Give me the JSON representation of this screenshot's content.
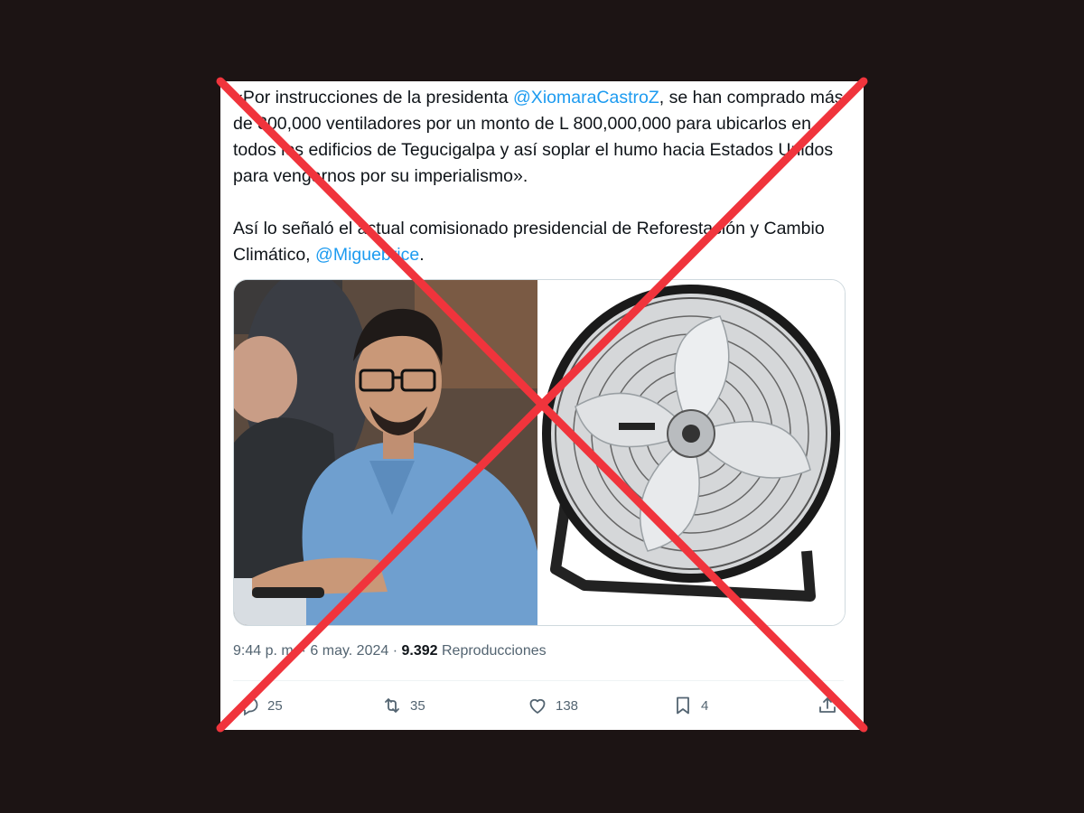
{
  "tweet": {
    "text_part1": "«Por instrucciones de la presidenta ",
    "mention1": "@XiomaraCastroZ",
    "text_part2": ", se han comprado más de 300,000 ventiladores por un monto de L 800,000,000 para ubicarlos en todos los edificios de Tegucigalpa y así soplar el humo hacia Estados Unidos para vengarnos por su imperialismo».",
    "text_part3": "Así lo señaló el actual comisionado presidencial de Reforestación y Cambio Climático, ",
    "mention2": "@Miguebrice",
    "text_part4": "."
  },
  "meta": {
    "time": "9:44 p. m.",
    "dot1": "·",
    "date": "6 may. 2024",
    "dot2": "·",
    "views": "9.392",
    "views_label": "Reproducciones"
  },
  "actions": {
    "replies": "25",
    "reposts": "35",
    "likes": "138",
    "bookmarks": "4"
  },
  "colors": {
    "background": "#1c1414",
    "mention": "#1d9bf0",
    "cross": "#f0343c",
    "text": "#0f1419",
    "muted": "#536471"
  },
  "icons": [
    "reply-icon",
    "repost-icon",
    "like-icon",
    "bookmark-icon",
    "share-icon"
  ]
}
